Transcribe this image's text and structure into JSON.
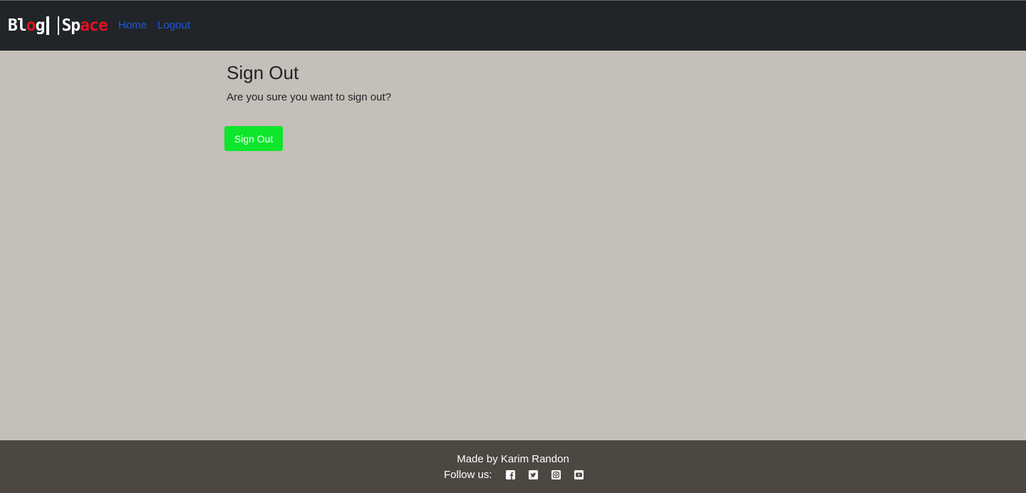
{
  "header": {
    "brand": {
      "part1": [
        "B",
        "l",
        "o",
        "g"
      ],
      "part2": [
        "S",
        "p",
        "a",
        "c",
        "e"
      ],
      "colors": {
        "white": "#ffffff",
        "red": "#e3101e"
      }
    },
    "nav": [
      {
        "label": "Home"
      },
      {
        "label": "Logout"
      }
    ],
    "link_color": "#1f58d6"
  },
  "main": {
    "title": "Sign Out",
    "prompt": "Are you sure you want to sign out?",
    "signout_label": "Sign Out",
    "button_color": "#0de62b"
  },
  "footer": {
    "made_by": "Made by Karim Randon",
    "follow_label": "Follow us:",
    "social_icons": [
      "facebook-icon",
      "twitter-icon",
      "instagram-icon",
      "youtube-icon"
    ],
    "background": "#4d4742"
  },
  "colors": {
    "page_background": "#c4bfb8",
    "navbar_background": "#212529"
  }
}
